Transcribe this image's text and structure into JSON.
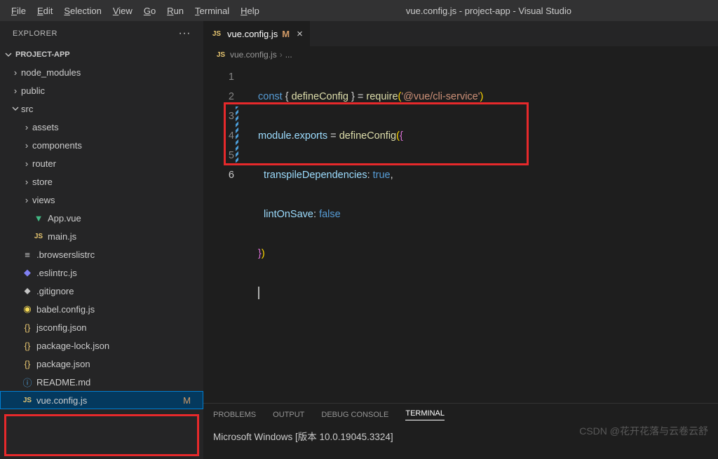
{
  "menu": [
    "File",
    "Edit",
    "Selection",
    "View",
    "Go",
    "Run",
    "Terminal",
    "Help"
  ],
  "window_title": "vue.config.js - project-app - Visual Studio",
  "explorer": {
    "title": "EXPLORER",
    "project": "PROJECT-APP",
    "tree": {
      "node_modules": "node_modules",
      "public": "public",
      "src": "src",
      "assets": "assets",
      "components": "components",
      "router": "router",
      "store": "store",
      "views": "views",
      "app_vue": "App.vue",
      "main_js": "main.js",
      "browserslistrc": ".browserslistrc",
      "eslintrc": ".eslintrc.js",
      "gitignore": ".gitignore",
      "babel": "babel.config.js",
      "jsconfig": "jsconfig.json",
      "pkglock": "package-lock.json",
      "pkg": "package.json",
      "readme": "README.md",
      "vueconfig": "vue.config.js",
      "m_badge": "M"
    }
  },
  "tab": {
    "label": "vue.config.js",
    "mod": "M",
    "close": "×"
  },
  "breadcrumb": {
    "file": "vue.config.js",
    "sep": "›",
    "ell": "..."
  },
  "lines": [
    "1",
    "2",
    "3",
    "4",
    "5",
    "6"
  ],
  "code": {
    "l1a": "const",
    "l1b": " { ",
    "l1c": "defineConfig",
    "l1d": " } = ",
    "l1e": "require",
    "l1f": "(",
    "l1g": "'@vue/cli-service'",
    "l1h": ")",
    "l2a": "module",
    "l2b": ".",
    "l2c": "exports",
    "l2d": " = ",
    "l2e": "defineConfig",
    "l2f": "(",
    "l2g": "{",
    "l3a": "  transpileDependencies",
    "l3b": ": ",
    "l3c": "true",
    "l3d": ",",
    "l4a": "  lintOnSave",
    "l4b": ": ",
    "l4c": "false",
    "l5a": "}",
    "l5b": ")"
  },
  "panel": {
    "tabs": [
      "PROBLEMS",
      "OUTPUT",
      "DEBUG CONSOLE",
      "TERMINAL"
    ],
    "terminal_line": "Microsoft Windows [版本 10.0.19045.3324]"
  },
  "watermark": "CSDN @花开花落与云卷云舒"
}
